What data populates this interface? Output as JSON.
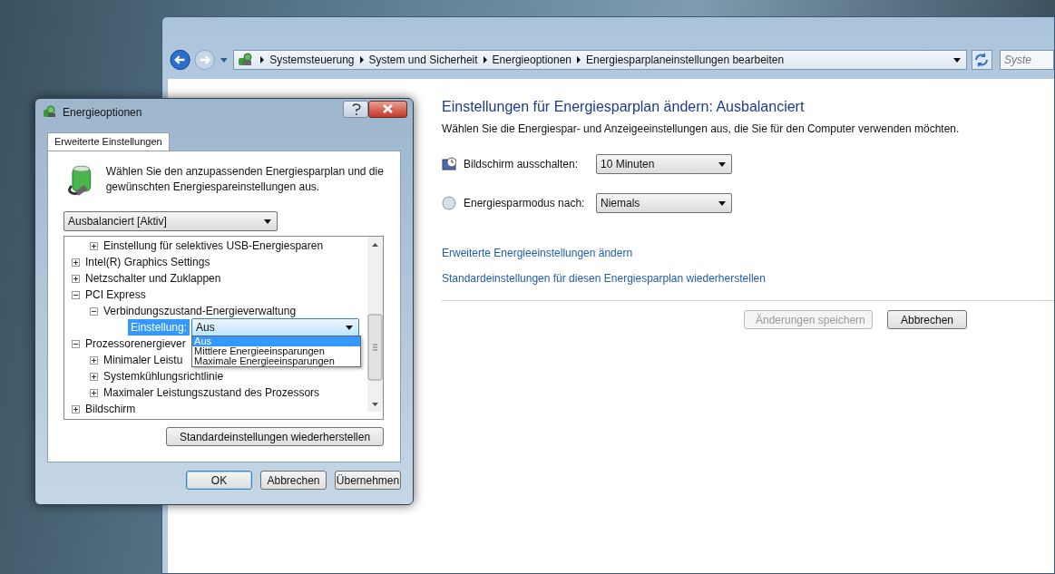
{
  "explorer": {
    "breadcrumbs": [
      "Systemsteuerung",
      "System und Sicherheit",
      "Energieoptionen",
      "Energiesparplaneinstellungen bearbeiten"
    ],
    "search": {
      "placeholder": "Syste"
    },
    "title": "Einstellungen für Energiesparplan ändern: Ausbalanciert",
    "subtitle": "Wählen Sie die Energiespar- und Anzeigeeinstellungen aus, die Sie für den Computer verwenden möchten.",
    "settings": [
      {
        "kind": "display",
        "label": "Bildschirm ausschalten:",
        "value": "10 Minuten"
      },
      {
        "kind": "sleep",
        "label": "Energiesparmodus nach:",
        "value": "Niemals"
      }
    ],
    "links": [
      "Erweiterte Energieeinstellungen ändern",
      "Standardeinstellungen für diesen Energiesparplan wiederherstellen"
    ],
    "buttons": [
      {
        "label": "Änderungen speichern",
        "disabled": true
      },
      {
        "label": "Abbrechen",
        "disabled": false
      }
    ]
  },
  "dialog": {
    "title": "Energieoptionen",
    "tabs": [
      {
        "label": "Erweiterte Einstellungen",
        "selected": true
      }
    ],
    "intro": "Wählen Sie den anzupassenden Energiesparplan und die gewünschten Energiespareinstellungen aus.",
    "plan": {
      "value": "Ausbalanciert [Aktiv]"
    },
    "tree": [
      {
        "children": [
          {
            "label": "Einstellung für selektives USB-Energiesparen",
            "expanded": false
          }
        ]
      },
      {
        "label": "Intel(R) Graphics Settings",
        "expanded": false
      },
      {
        "label": "Netzschalter und Zuklappen",
        "expanded": false
      },
      {
        "label": "PCI Express",
        "expanded": true,
        "children": [
          {
            "label": "Verbindungszustand-Energieverwaltung",
            "expanded": true,
            "children": [
              {
                "kind": "setting",
                "label": "Einstellung:",
                "value": "Aus",
                "options": [
                  {
                    "label": "Aus",
                    "selected": true
                  },
                  {
                    "label": "Mittlere Energieeinsparungen",
                    "selected": false
                  },
                  {
                    "label": "Maximale Energieeinsparungen",
                    "selected": false
                  }
                ]
              }
            ]
          }
        ]
      },
      {
        "label": "Prozessorenergiever",
        "expanded": true,
        "children": [
          {
            "label": "Minimaler Leistu",
            "expanded": false
          },
          {
            "label": "Systemkühlungsrichtlinie",
            "expanded": false
          },
          {
            "label": "Maximaler Leistungszustand des Prozessors",
            "expanded": false
          }
        ]
      },
      {
        "label": "Bildschirm",
        "expanded": false
      }
    ],
    "restore_button": "Standardeinstellungen wiederherstellen",
    "buttons": [
      {
        "label": "OK",
        "default": true
      },
      {
        "label": "Abbrechen",
        "default": false
      },
      {
        "label": "Übernehmen",
        "default": false
      }
    ]
  }
}
